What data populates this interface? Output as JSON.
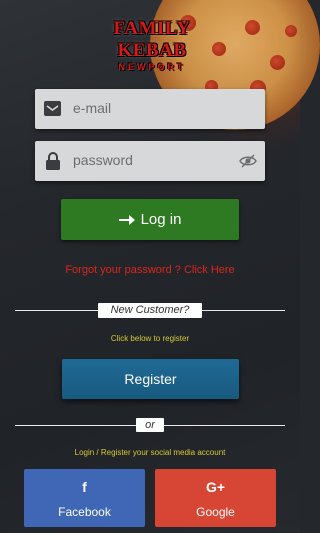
{
  "brand": {
    "name": "FAMILY KEBAB",
    "location": "NEWPORT"
  },
  "login": {
    "email_placeholder": "e-mail",
    "password_placeholder": "password",
    "login_label": "Log in",
    "forgot_text": "Forgot your password ? Click Here"
  },
  "register": {
    "new_customer": "New Customer?",
    "hint": "Click below to register",
    "button_label": "Register"
  },
  "social": {
    "or_label": "or",
    "hint": "Login / Register your social media account",
    "facebook_label": "Facebook",
    "facebook_icon": "f",
    "google_label": "Google",
    "google_icon": "G+"
  },
  "colors": {
    "login_green": "#2e7a22",
    "register_blue": "#1f6a94",
    "facebook_blue": "#3f67b5",
    "google_red": "#d74634",
    "forgot_red": "#e0241c",
    "hint_yellow": "#d8c934"
  }
}
